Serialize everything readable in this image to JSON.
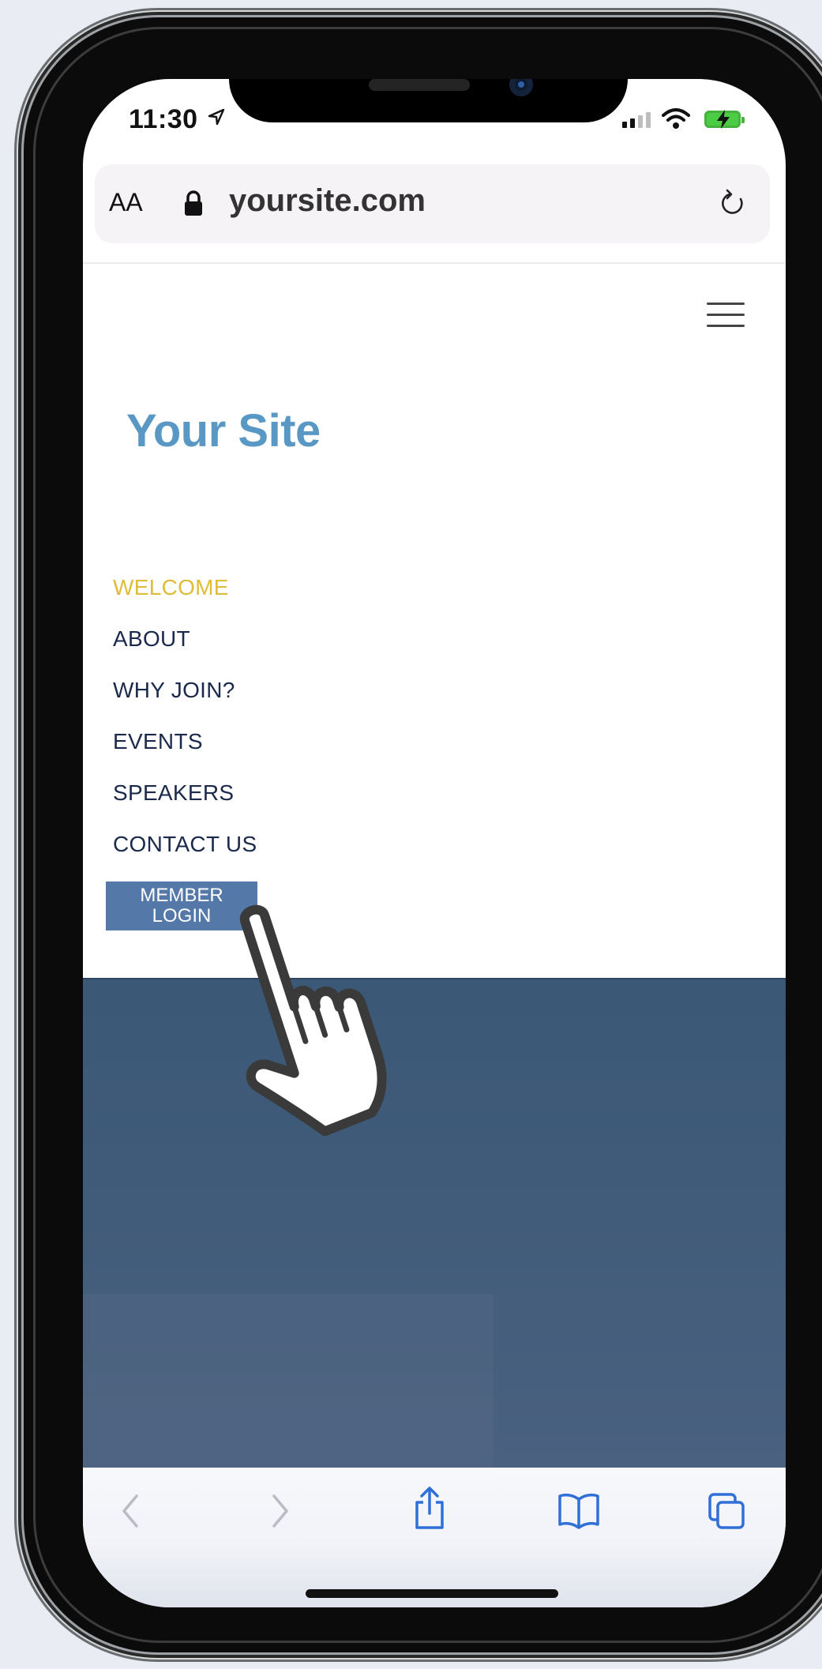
{
  "status_bar": {
    "time": "11:30"
  },
  "browser": {
    "text_size_label": "AA",
    "url": "yoursite.com"
  },
  "site": {
    "title": "Your Site",
    "nav": [
      {
        "label": "WELCOME",
        "active": true
      },
      {
        "label": "ABOUT",
        "active": false
      },
      {
        "label": "WHY JOIN?",
        "active": false
      },
      {
        "label": "EVENTS",
        "active": false
      },
      {
        "label": "SPEAKERS",
        "active": false
      },
      {
        "label": "CONTACT US",
        "active": false
      }
    ],
    "member_login": {
      "line1": "MEMBER",
      "line2": "LOGIN"
    }
  },
  "toolbar": {
    "icons": [
      "back-icon",
      "forward-icon",
      "share-icon",
      "bookmarks-icon",
      "tabs-icon"
    ]
  },
  "colors": {
    "site_title": "#5998c4",
    "nav_active": "#e0bc38",
    "nav_text": "#1b2a4c",
    "member_button": "#5478a8",
    "hero": "#415c7a",
    "safari_blue": "#2f6fd6"
  }
}
